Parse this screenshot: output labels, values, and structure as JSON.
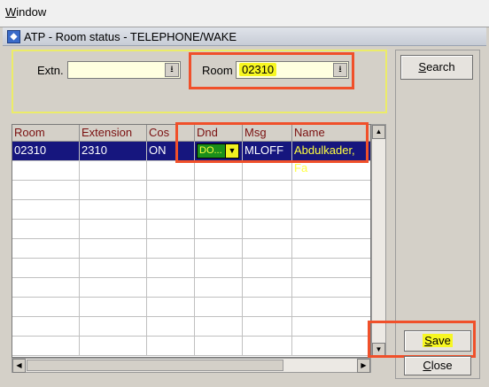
{
  "menubar": {
    "window_prefix": "W",
    "window_rest": "indow"
  },
  "window": {
    "icon_glyph": "◆",
    "title": "ATP - Room status - TELEPHONE/WAKE"
  },
  "filters": {
    "extn_label": "Extn.",
    "extn_value": "",
    "room_label": "Room",
    "room_value": "02310",
    "dropdown_glyph": "⭳"
  },
  "buttons": {
    "search_u": "S",
    "search_rest": "earch",
    "save_u": "S",
    "save_rest": "ave",
    "close_u": "C",
    "close_rest": "lose"
  },
  "grid": {
    "headers": [
      "Room",
      "Extension",
      "Cos",
      "Dnd",
      "Msg",
      "Name"
    ],
    "rows": [
      {
        "room": "02310",
        "extension": "2310",
        "cos": "ON",
        "dnd": "DO...",
        "msg": "MLOFF",
        "name": "Abdulkader, Fa"
      }
    ],
    "empty_rows": 10
  },
  "glyphs": {
    "down": "▼",
    "up": "▲",
    "left": "◀",
    "right": "▶"
  },
  "colors": {
    "highlight_yellow": "#f7f722",
    "annotation_red": "#f0502a",
    "selection_navy": "#16167e",
    "header_text": "#7a1010"
  }
}
